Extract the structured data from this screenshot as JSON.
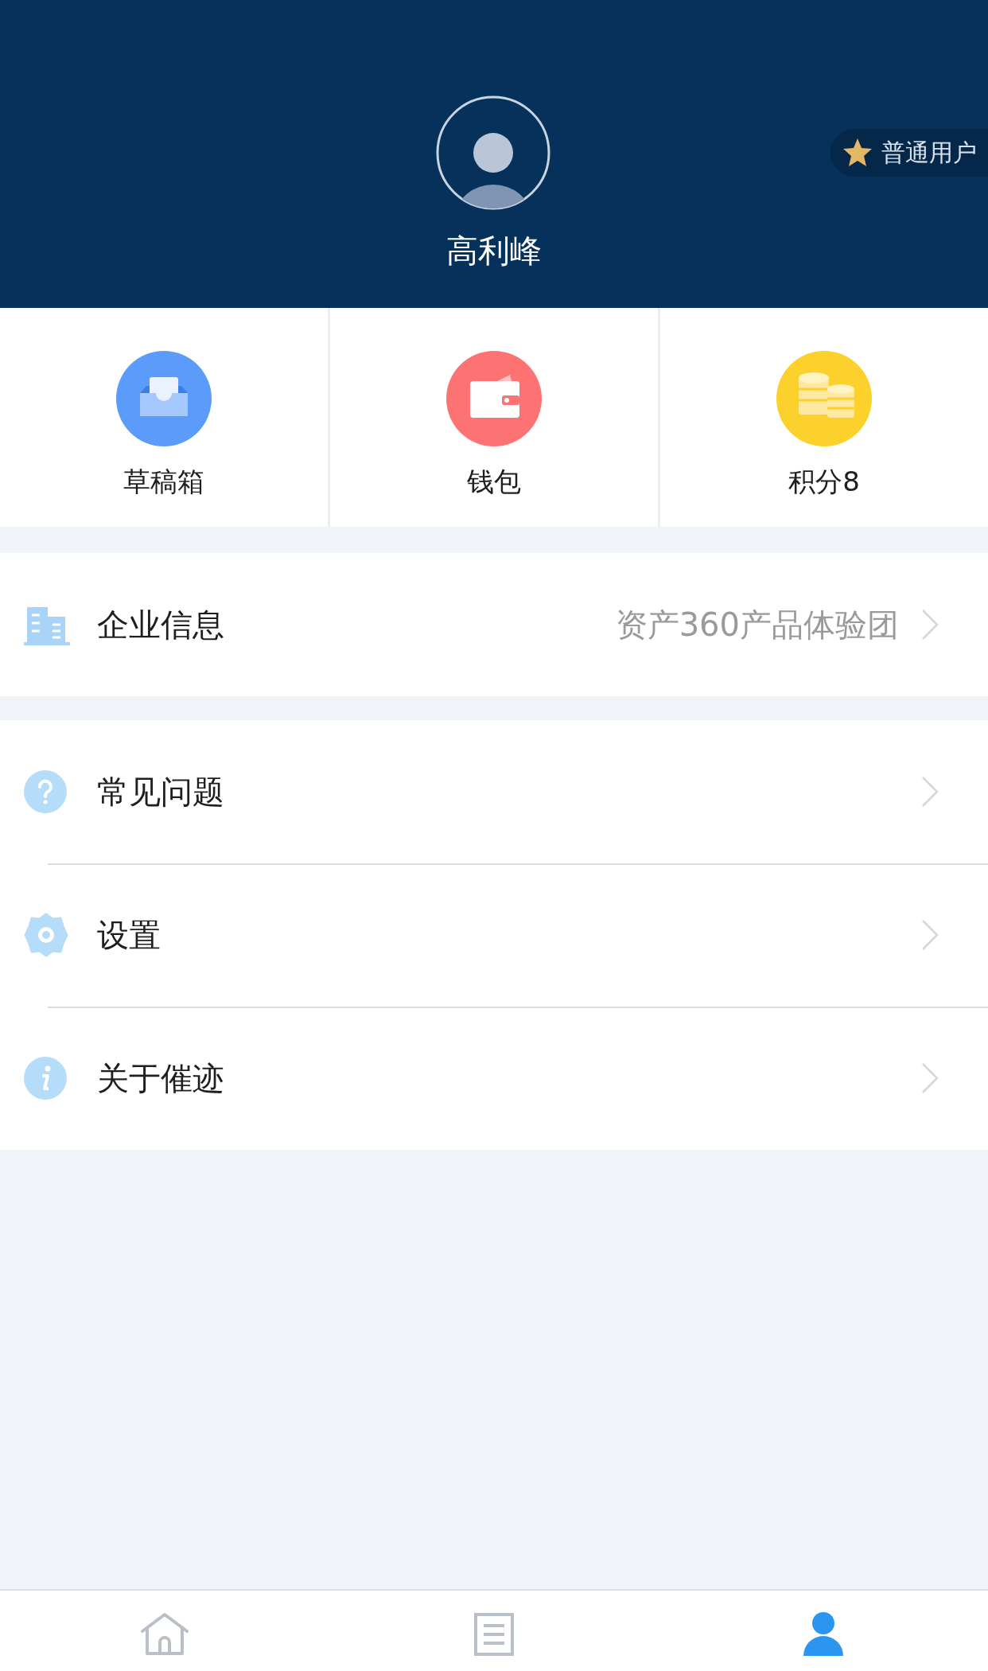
{
  "profile": {
    "name": "高利峰",
    "badge": "普通用户"
  },
  "shortcuts": [
    {
      "kind": "drafts",
      "label": "草稿箱"
    },
    {
      "kind": "wallet",
      "label": "钱包"
    },
    {
      "kind": "points",
      "label": "积分8"
    }
  ],
  "company": {
    "kind": "company",
    "label": "企业信息",
    "value": "资产360产品体验团"
  },
  "menu": [
    {
      "kind": "help",
      "label": "常见问题"
    },
    {
      "kind": "settings",
      "label": "设置"
    },
    {
      "kind": "about",
      "label": "关于催迹"
    }
  ],
  "tab_bar": [
    {
      "kind": "home",
      "selected": false
    },
    {
      "kind": "list",
      "selected": false
    },
    {
      "kind": "profile",
      "selected": true
    }
  ]
}
